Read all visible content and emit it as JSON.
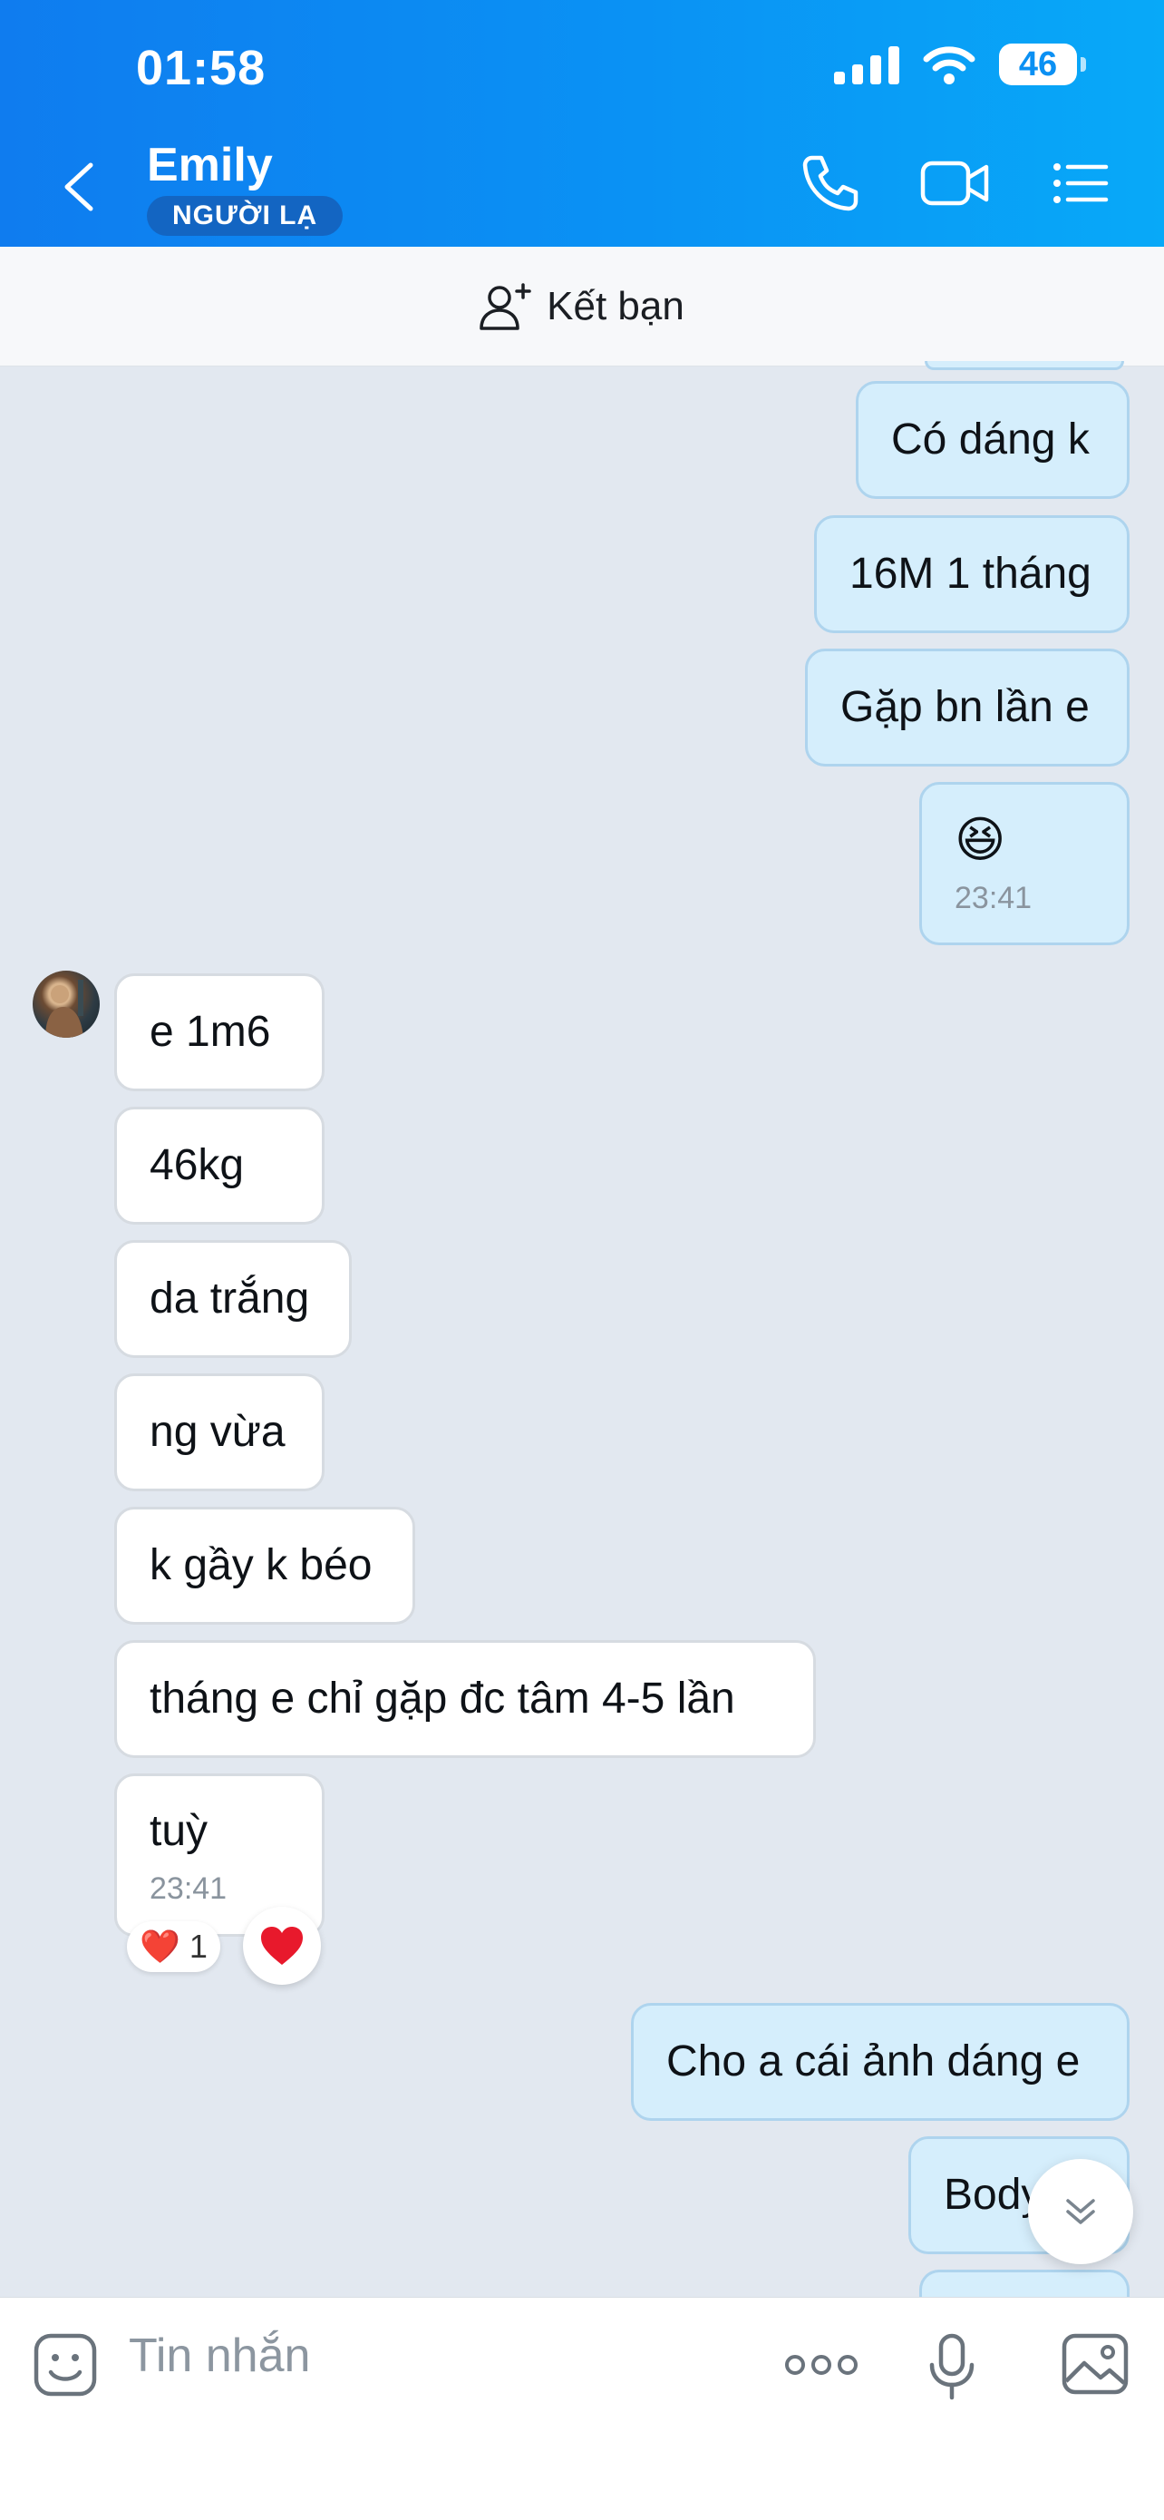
{
  "status_bar": {
    "time": "01:58",
    "battery": "46"
  },
  "header": {
    "name": "Emily",
    "badge": "NGƯỜI LẠ",
    "icons": [
      "back-icon",
      "phone-icon",
      "video-icon",
      "menu-list-icon"
    ]
  },
  "friend_bar": {
    "label": "Kết bạn",
    "icon": "add-user-icon"
  },
  "messages": [
    {
      "dir": "out",
      "text": "Có dáng k"
    },
    {
      "dir": "out",
      "text": "16M 1 tháng"
    },
    {
      "dir": "out",
      "text": "Gặp bn lần e"
    },
    {
      "dir": "out",
      "text": "😆",
      "time": "23:41"
    },
    {
      "dir": "in",
      "text": "e 1m6"
    },
    {
      "dir": "in",
      "text": "46kg"
    },
    {
      "dir": "in",
      "text": "da trắng"
    },
    {
      "dir": "in",
      "text": "ng vừa"
    },
    {
      "dir": "in",
      "text": "k gầy k béo"
    },
    {
      "dir": "in",
      "text": "tháng e chỉ gặp đc tâm 4-5 lần"
    },
    {
      "dir": "in",
      "text": "tuỳ",
      "time": "23:41"
    },
    {
      "dir": "out",
      "text": "Cho a cái ảnh dáng e"
    },
    {
      "dir": "out",
      "text": "Body"
    }
  ],
  "reaction": {
    "emoji": "❤️",
    "count": "1"
  },
  "composer": {
    "placeholder": "Tin nhắn"
  },
  "colors": {
    "header_start": "#0f7cef",
    "header_end": "#08a9f8",
    "outgoing_bubble": "#d5eefc",
    "incoming_bubble": "#ffffff",
    "chat_bg": "#e2e8f0"
  }
}
